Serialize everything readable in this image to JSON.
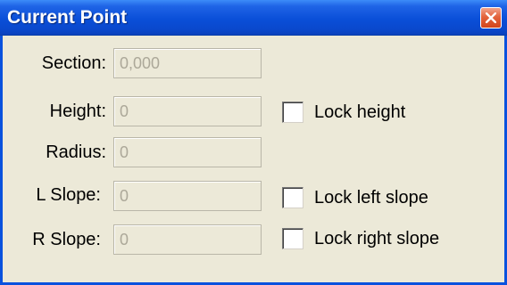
{
  "window": {
    "title": "Current Point",
    "close_icon": "close-icon"
  },
  "fields": [
    {
      "label": "Section:",
      "value": "0,000"
    },
    {
      "label": "Height:",
      "value": "0"
    },
    {
      "label": "Radius:",
      "value": "0"
    },
    {
      "label": "L Slope:",
      "value": "0"
    },
    {
      "label": "R Slope:",
      "value": "0"
    }
  ],
  "checkboxes": [
    {
      "label": "Lock height",
      "checked": false
    },
    {
      "label": "Lock left slope",
      "checked": false
    },
    {
      "label": "Lock right slope",
      "checked": false
    }
  ],
  "colors": {
    "titlebar": "#0A4FD8",
    "window_background": "#ECE9D8",
    "disabled_text": "#ACA899",
    "close_button": "#E3633C"
  }
}
